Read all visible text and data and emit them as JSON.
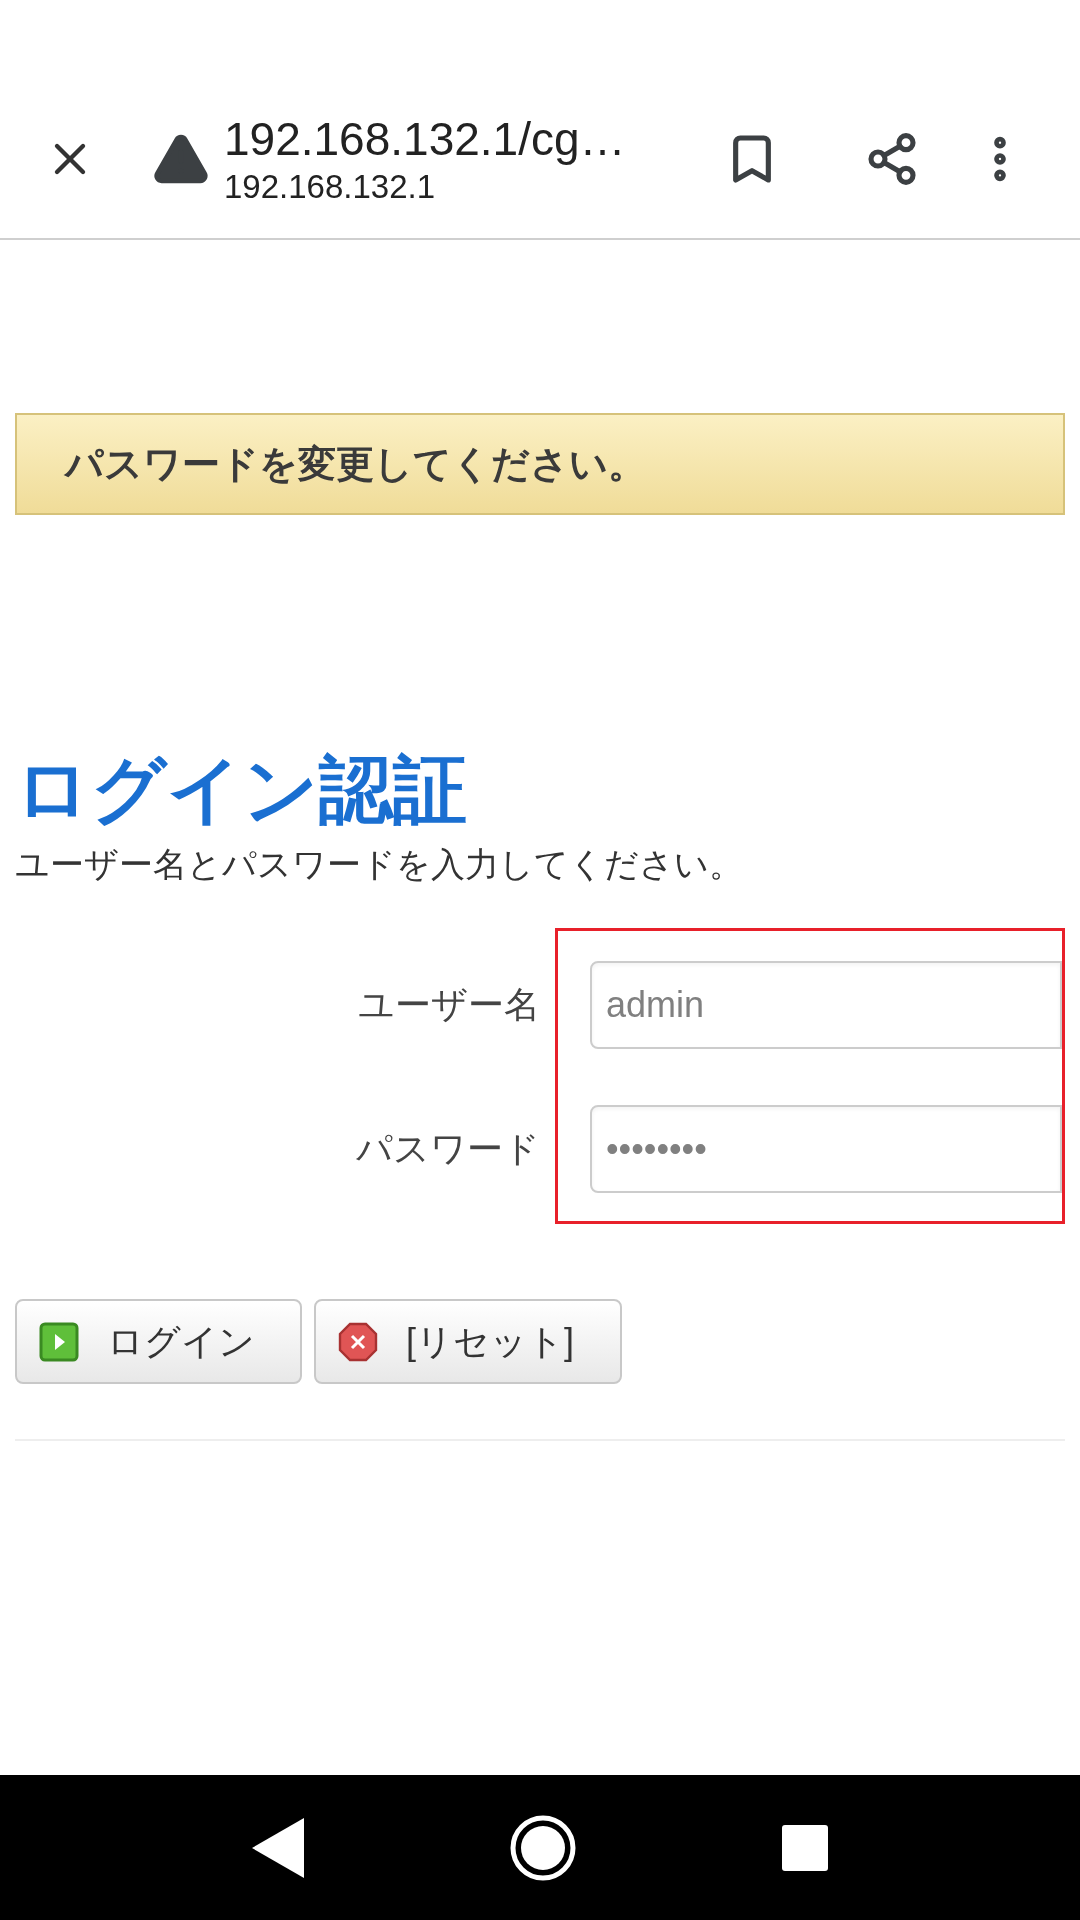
{
  "browser_bar": {
    "title": "192.168.132.1/cg…",
    "host": "192.168.132.1"
  },
  "notice": "パスワードを変更してください。",
  "heading": "ログイン認証",
  "instruction": "ユーザー名とパスワードを入力してください。",
  "fields": [
    {
      "label": "ユーザー名",
      "value": "admin"
    },
    {
      "label": "パスワード",
      "value": "••••••••"
    }
  ],
  "buttons": [
    {
      "kind": "play",
      "label": "ログイン"
    },
    {
      "kind": "cancel",
      "label": "[リセット]"
    }
  ]
}
